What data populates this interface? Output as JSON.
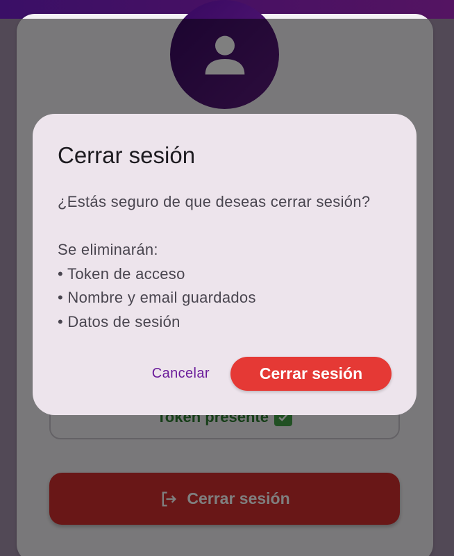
{
  "background": {
    "status_text": "Token presente",
    "logout_button_label": "Cerrar sesión"
  },
  "dialog": {
    "title": "Cerrar sesión",
    "question": "¿Estás seguro de que deseas cerrar sesión?",
    "list_intro": "Se eliminarán:",
    "items": [
      "• Token de acceso",
      "• Nombre y email guardados",
      "• Datos de sesión"
    ],
    "cancel_label": "Cancelar",
    "confirm_label": "Cerrar sesión"
  },
  "colors": {
    "primary": "#4a1163",
    "danger": "#e53935",
    "dialog_bg": "#ede4ec",
    "accent_text": "#6a1b9a"
  }
}
